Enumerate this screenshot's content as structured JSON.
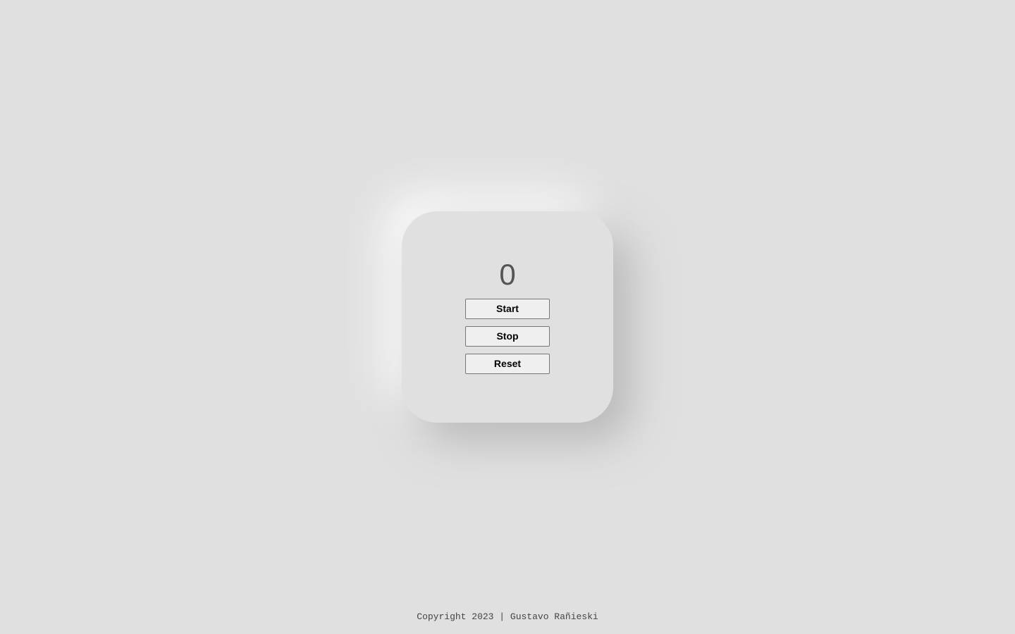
{
  "stopwatch": {
    "count": "0",
    "buttons": {
      "start_label": "Start",
      "stop_label": "Stop",
      "reset_label": "Reset"
    }
  },
  "footer": {
    "copyright": "Copyright 2023 | Gustavo Rañieski"
  },
  "colors": {
    "background": "#e0e0e0",
    "counter_text": "#555555",
    "button_bg": "#efefef",
    "button_border": "#767676"
  }
}
